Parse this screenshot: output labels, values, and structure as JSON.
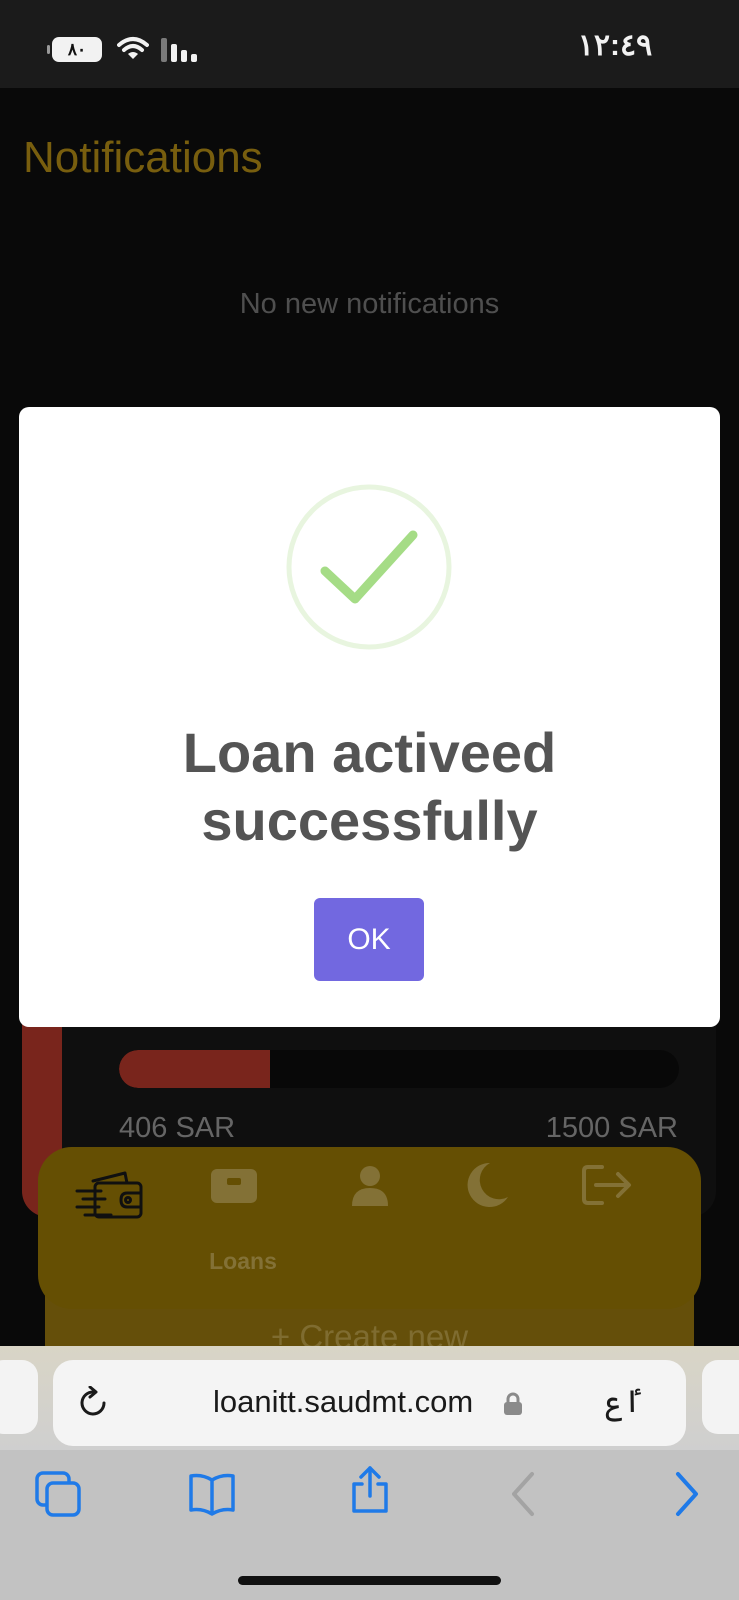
{
  "status_bar": {
    "battery": "٨٠",
    "time": "١٢:٤٩"
  },
  "page": {
    "title": "Notifications",
    "empty_message": "No new notifications"
  },
  "loan_card": {
    "paid_amount": "406 SAR",
    "total_amount": "1500 SAR",
    "progress_fraction": 0.27,
    "accent_color": "#bb3a2b"
  },
  "create_bar": {
    "label": "+ Create new"
  },
  "bottom_nav": {
    "items": [
      {
        "icon": "wallet-icon",
        "label": ""
      },
      {
        "icon": "briefcase-icon",
        "label": "Loans"
      },
      {
        "icon": "user-icon",
        "label": ""
      },
      {
        "icon": "moon-icon",
        "label": ""
      },
      {
        "icon": "logout-icon",
        "label": ""
      }
    ],
    "background_color": "#9b7a05"
  },
  "modal": {
    "icon": "success-check-icon",
    "title": "Loan activeed successfully",
    "ok_label": "OK",
    "button_color": "#7268e0",
    "check_color": "#a5dc86"
  },
  "browser": {
    "url": "loanitt.saudmt.com",
    "reader_label": "ٵع",
    "toolbar": [
      "tabs-icon",
      "bookmarks-icon",
      "share-icon",
      "back-icon",
      "forward-icon"
    ],
    "accent_color": "#1f7ae8"
  }
}
